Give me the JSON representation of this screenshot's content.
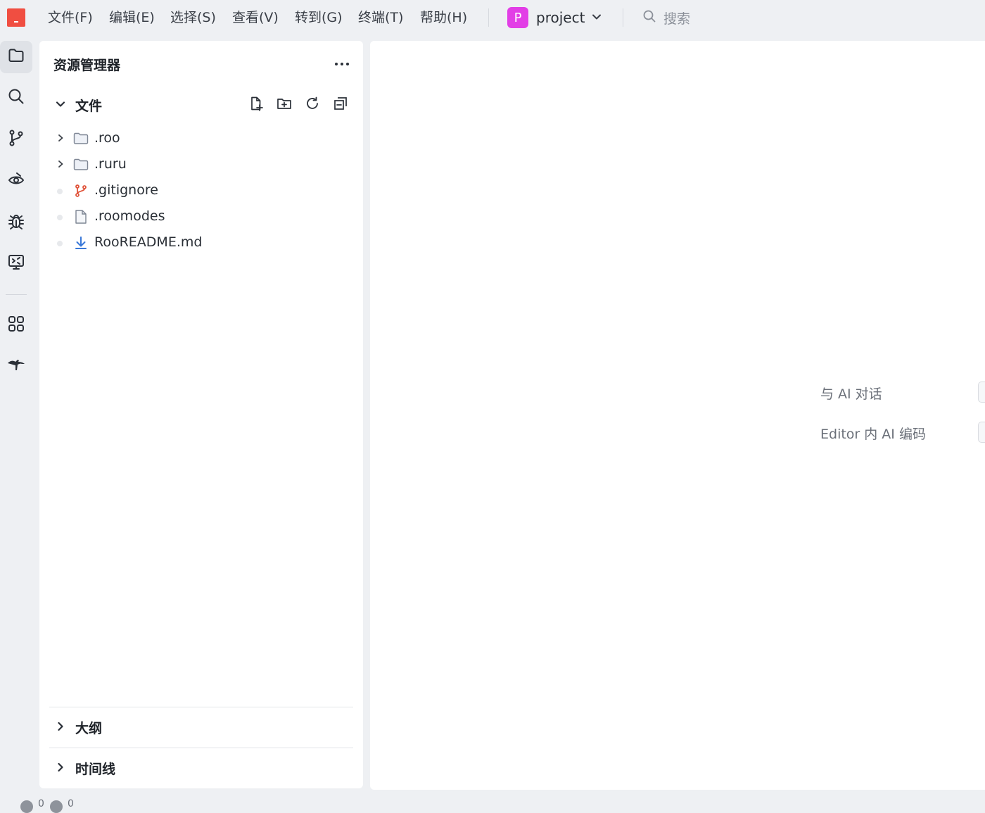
{
  "menu": [
    "文件(F)",
    "编辑(E)",
    "选择(S)",
    "查看(V)",
    "转到(G)",
    "终端(T)",
    "帮助(H)"
  ],
  "project": {
    "initial": "P",
    "name": "project",
    "avatar_color": "#e23ee6"
  },
  "search": {
    "label": "搜索"
  },
  "activity_bar": {
    "icons": [
      "explorer-icon",
      "search-icon",
      "source-control-icon",
      "preview-icon",
      "debug-icon",
      "remote-icon",
      "extensions-icon",
      "kangaroo-icon"
    ]
  },
  "explorer": {
    "title": "资源管理器",
    "files_section": "文件",
    "items": [
      {
        "name": ".roo",
        "type": "folder"
      },
      {
        "name": ".ruru",
        "type": "folder"
      },
      {
        "name": ".gitignore",
        "type": "git"
      },
      {
        "name": ".roomodes",
        "type": "file"
      },
      {
        "name": "RooREADME.md",
        "type": "markdown"
      }
    ],
    "sections": [
      "大纲",
      "时间线"
    ]
  },
  "editor": {
    "hints": [
      "与 AI 对话",
      "Editor 内 AI 编码"
    ]
  },
  "status": {
    "errors": "0",
    "warnings": "0"
  },
  "colors": {
    "brand": "#f04e41",
    "accent": "#3a78d8",
    "git": "#e0533a"
  }
}
